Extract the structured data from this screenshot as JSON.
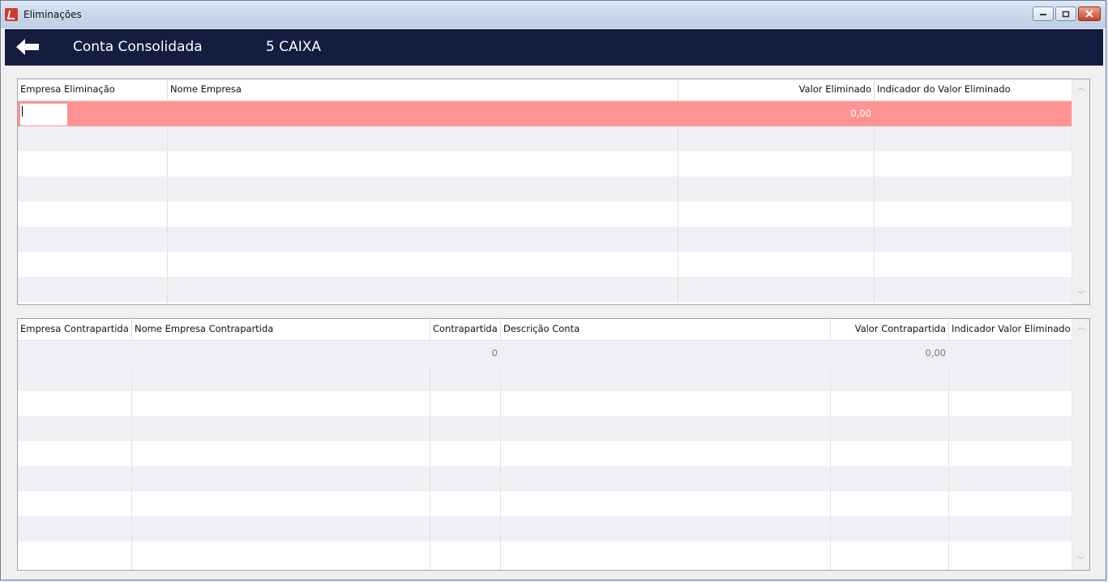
{
  "window": {
    "title": "Eliminações",
    "icons": {
      "app": "app-logo-icon",
      "minimize": "minimize-icon",
      "maximize": "maximize-icon",
      "close": "close-icon"
    }
  },
  "header": {
    "back_icon": "arrow-left-icon",
    "label": "Conta Consolidada",
    "value": "5  CAIXA"
  },
  "grid1": {
    "columns": [
      "Empresa Eliminação",
      "Nome Empresa",
      "Valor Eliminado",
      "Indicador do Valor Eliminado"
    ],
    "rows": [
      {
        "valor_eliminado": "0,00"
      }
    ]
  },
  "grid2": {
    "columns": [
      "Empresa Contrapartida",
      "Nome Empresa Contrapartida",
      "Contrapartida",
      "Descrição Conta",
      "Valor Contrapartida",
      "Indicador Valor Eliminado"
    ],
    "rows": [
      {
        "contrapartida": "0",
        "valor_contrapartida": "0,00"
      }
    ]
  },
  "colors": {
    "header_bg": "#141d3f",
    "selected_row": "#ff9393",
    "alt_row": "#eff0f4"
  }
}
